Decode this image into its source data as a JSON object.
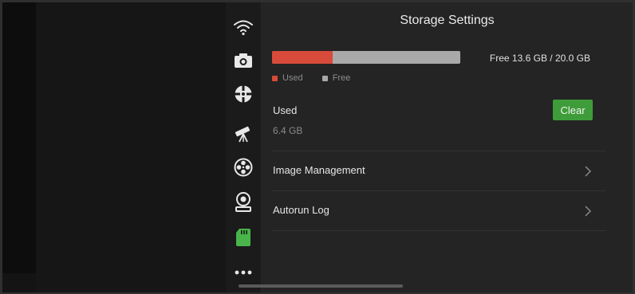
{
  "header": {
    "title": "Storage Settings"
  },
  "storage": {
    "used_fraction": 0.32,
    "free_text": "Free 13.6 GB / 20.0 GB",
    "legend": {
      "used": "Used",
      "free": "Free"
    },
    "used_label": "Used",
    "used_value": "6.4 GB",
    "clear_label": "Clear"
  },
  "menu": [
    {
      "label": "Image Management"
    },
    {
      "label": "Autorun Log"
    }
  ],
  "sidebar": {
    "icons": [
      "wifi-icon",
      "camera-icon",
      "target-icon",
      "telescope-icon",
      "reel-icon",
      "webcam-icon",
      "sd-card-icon",
      "more-icon"
    ],
    "active": "sd-card-icon"
  },
  "colors": {
    "used": "#d84a3a",
    "free": "#a9a9a9",
    "accent_green": "#3f9c3a"
  }
}
